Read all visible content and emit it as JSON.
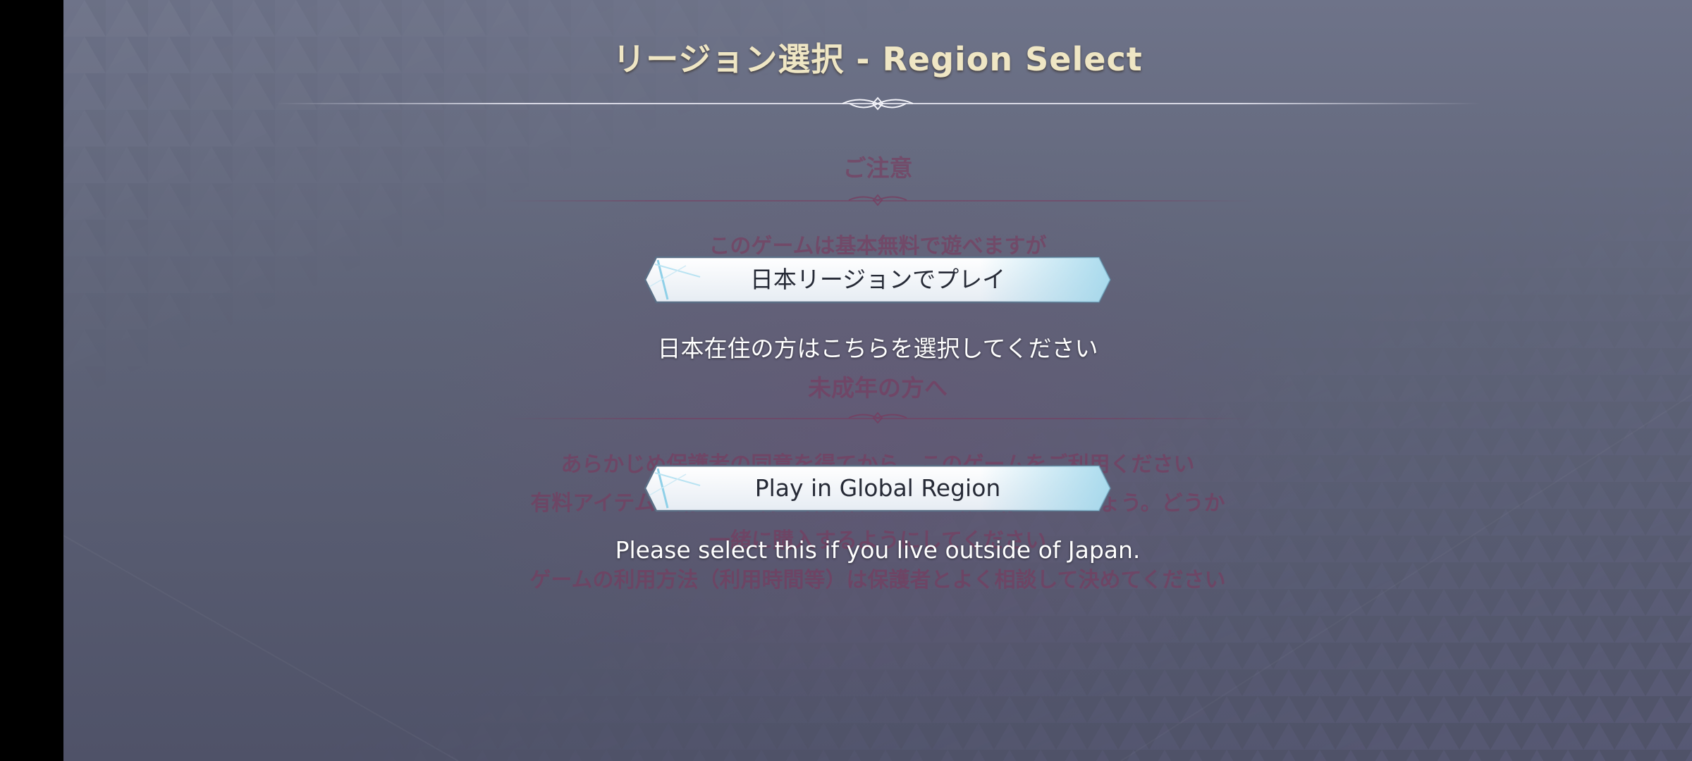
{
  "header": {
    "title": "リージョン選択 - Region Select"
  },
  "notice": {
    "heading1": "ご注意",
    "line1": "このゲームは基本無料で遊べますが",
    "heading2": "未成年の方へ",
    "line2": "あらかじめ保護者の同意を得てから、このゲームをご利用ください",
    "line3": "有料アイテムを購入する際は保護者の方と一緒に購入しましょう。どうか",
    "line4": "一緒に購入するようにしてください",
    "line5": "ゲームの利用方法（利用時間等）は保護者とよく相談して決めてください"
  },
  "regions": {
    "japan": {
      "button_label": "日本リージョンでプレイ",
      "caption": "日本在住の方はこちらを選択してください"
    },
    "global": {
      "button_label": "Play in Global Region",
      "caption": "Please select this if you live outside of Japan."
    }
  },
  "colors": {
    "title": "#efe6c4",
    "faded_notice": "#7a3a5e",
    "button_text": "#262a36",
    "button_fill": "#f4f7fb",
    "button_accent": "#8fd0e8"
  }
}
